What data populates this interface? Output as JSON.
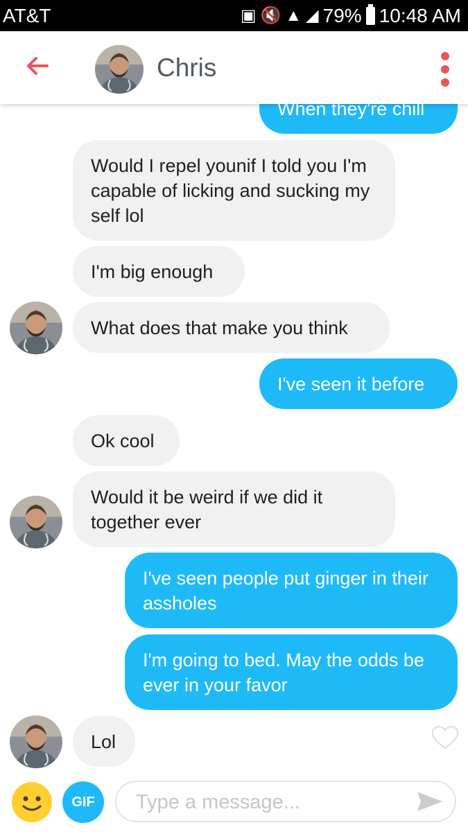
{
  "status_bar": {
    "carrier": "AT&T",
    "battery": "79%",
    "time": "10:48 AM"
  },
  "header": {
    "name": "Chris"
  },
  "messages": [
    {
      "from": "me",
      "text": "When they're chill"
    },
    {
      "from": "them",
      "text": "Would I repel younif I told you I'm capable of licking and sucking my self lol"
    },
    {
      "from": "them",
      "text": "I'm big enough"
    },
    {
      "from": "them",
      "text": "What does that make you think"
    },
    {
      "from": "me",
      "text": "I've seen it before"
    },
    {
      "from": "them",
      "text": "Ok cool"
    },
    {
      "from": "them",
      "text": "Would it be weird if we did it together ever"
    },
    {
      "from": "me",
      "text": "I've seen people put ginger in their assholes"
    },
    {
      "from": "me",
      "text": "I'm going to bed. May the odds be ever in your favor"
    },
    {
      "from": "them",
      "text": "Lol"
    }
  ],
  "input": {
    "gif_label": "GIF",
    "placeholder": "Type a message..."
  },
  "colors": {
    "accent": "#1ebaf8",
    "incoming_bubble": "#f1f1f1",
    "back_arrow": "#f0525a"
  }
}
